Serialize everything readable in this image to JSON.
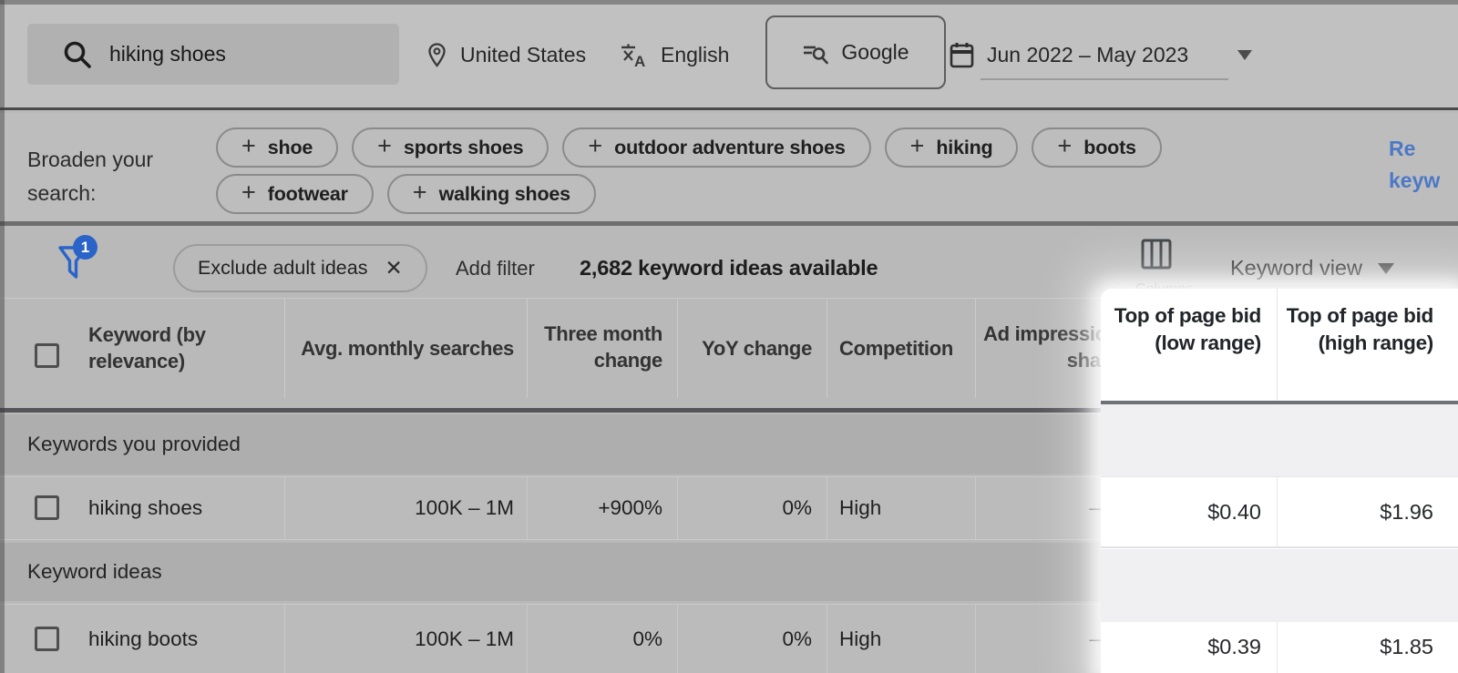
{
  "topbar": {
    "search": {
      "value": "hiking shoes"
    },
    "location": "United States",
    "language": "English",
    "network": "Google",
    "date_range": "Jun 2022 – May 2023"
  },
  "broaden": {
    "label": "Broaden your search:",
    "plus_icon": "+",
    "pills": [
      "shoe",
      "sports shoes",
      "outdoor adventure shoes",
      "hiking",
      "boots",
      "footwear",
      "walking shoes"
    ],
    "refine": {
      "line1": "Re",
      "line2": "keyw"
    }
  },
  "filterbar": {
    "filter_count": "1",
    "chip": "Exclude adult ideas",
    "close_icon": "✕",
    "add_filter": "Add filter",
    "ideas_count": "2,682 keyword ideas available",
    "columns_label": "Columns",
    "view": "Keyword view"
  },
  "table": {
    "headers": {
      "keyword": "Keyword (by relevance)",
      "avg_monthly": "Avg. monthly searches",
      "three_month": "Three month change",
      "yoy": "YoY change",
      "competition": "Competition",
      "ad_impression": "Ad impression share",
      "bid_low": "Top of page bid (low range)",
      "bid_high": "Top of page bid (high range)"
    },
    "sections": [
      "Keywords you provided",
      "Keyword ideas"
    ],
    "rows": [
      {
        "keyword": "hiking shoes",
        "avg_monthly": "100K – 1M",
        "three_month": "+900%",
        "yoy": "0%",
        "competition": "High",
        "ad_impression": "–",
        "bid_low": "$0.40",
        "bid_high": "$1.96"
      },
      {
        "keyword": "hiking boots",
        "avg_monthly": "100K – 1M",
        "three_month": "0%",
        "yoy": "0%",
        "competition": "High",
        "ad_impression": "–",
        "bid_low": "$0.39",
        "bid_high": "$1.85"
      }
    ]
  },
  "colors": {
    "accent_blue": "#2a64c9",
    "highlight_bg": "#ffffff"
  }
}
